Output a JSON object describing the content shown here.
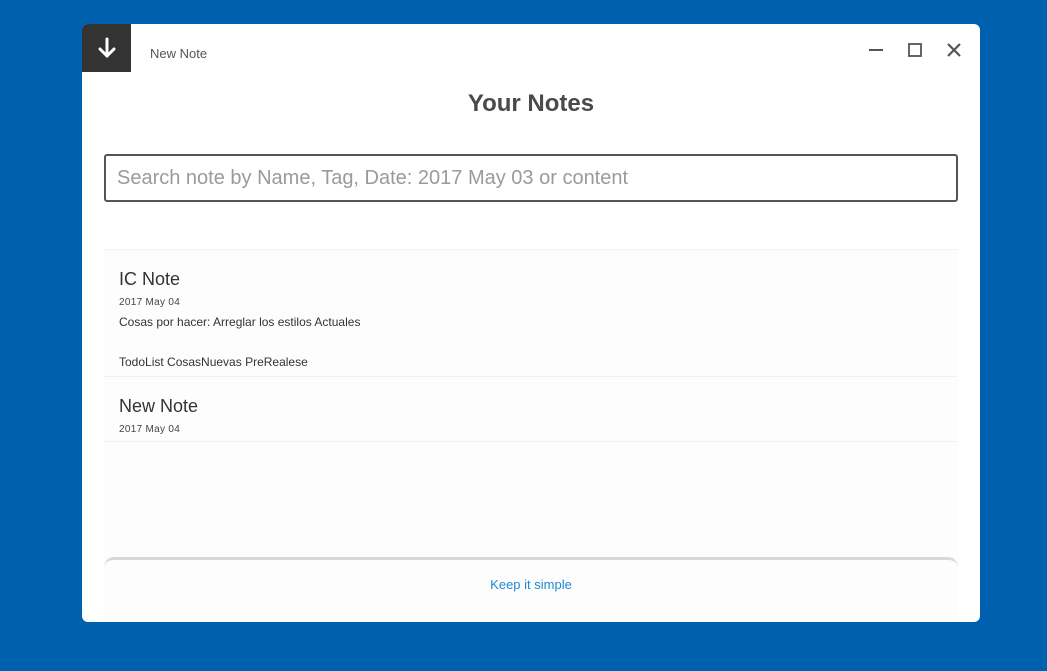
{
  "window": {
    "title": "New Note"
  },
  "main": {
    "heading": "Your Notes"
  },
  "search": {
    "placeholder": "Search note by Name, Tag, Date: 2017 May 03 or content",
    "value": ""
  },
  "notes": [
    {
      "title": "IC Note",
      "date": "2017 May 04",
      "content": "Cosas por hacer: Arreglar los estilos Actuales",
      "tags": "TodoList CosasNuevas PreRealese"
    },
    {
      "title": "New Note",
      "date": "2017 May 04"
    }
  ],
  "footer": {
    "link": "Keep it simple"
  },
  "colors": {
    "background": "#0060b0",
    "accent_dark": "#333333",
    "link": "#1d8ad0"
  },
  "icons": {
    "new_note": "arrow-down-icon",
    "minimize": "minimize-icon",
    "maximize": "maximize-icon",
    "close": "close-icon"
  }
}
